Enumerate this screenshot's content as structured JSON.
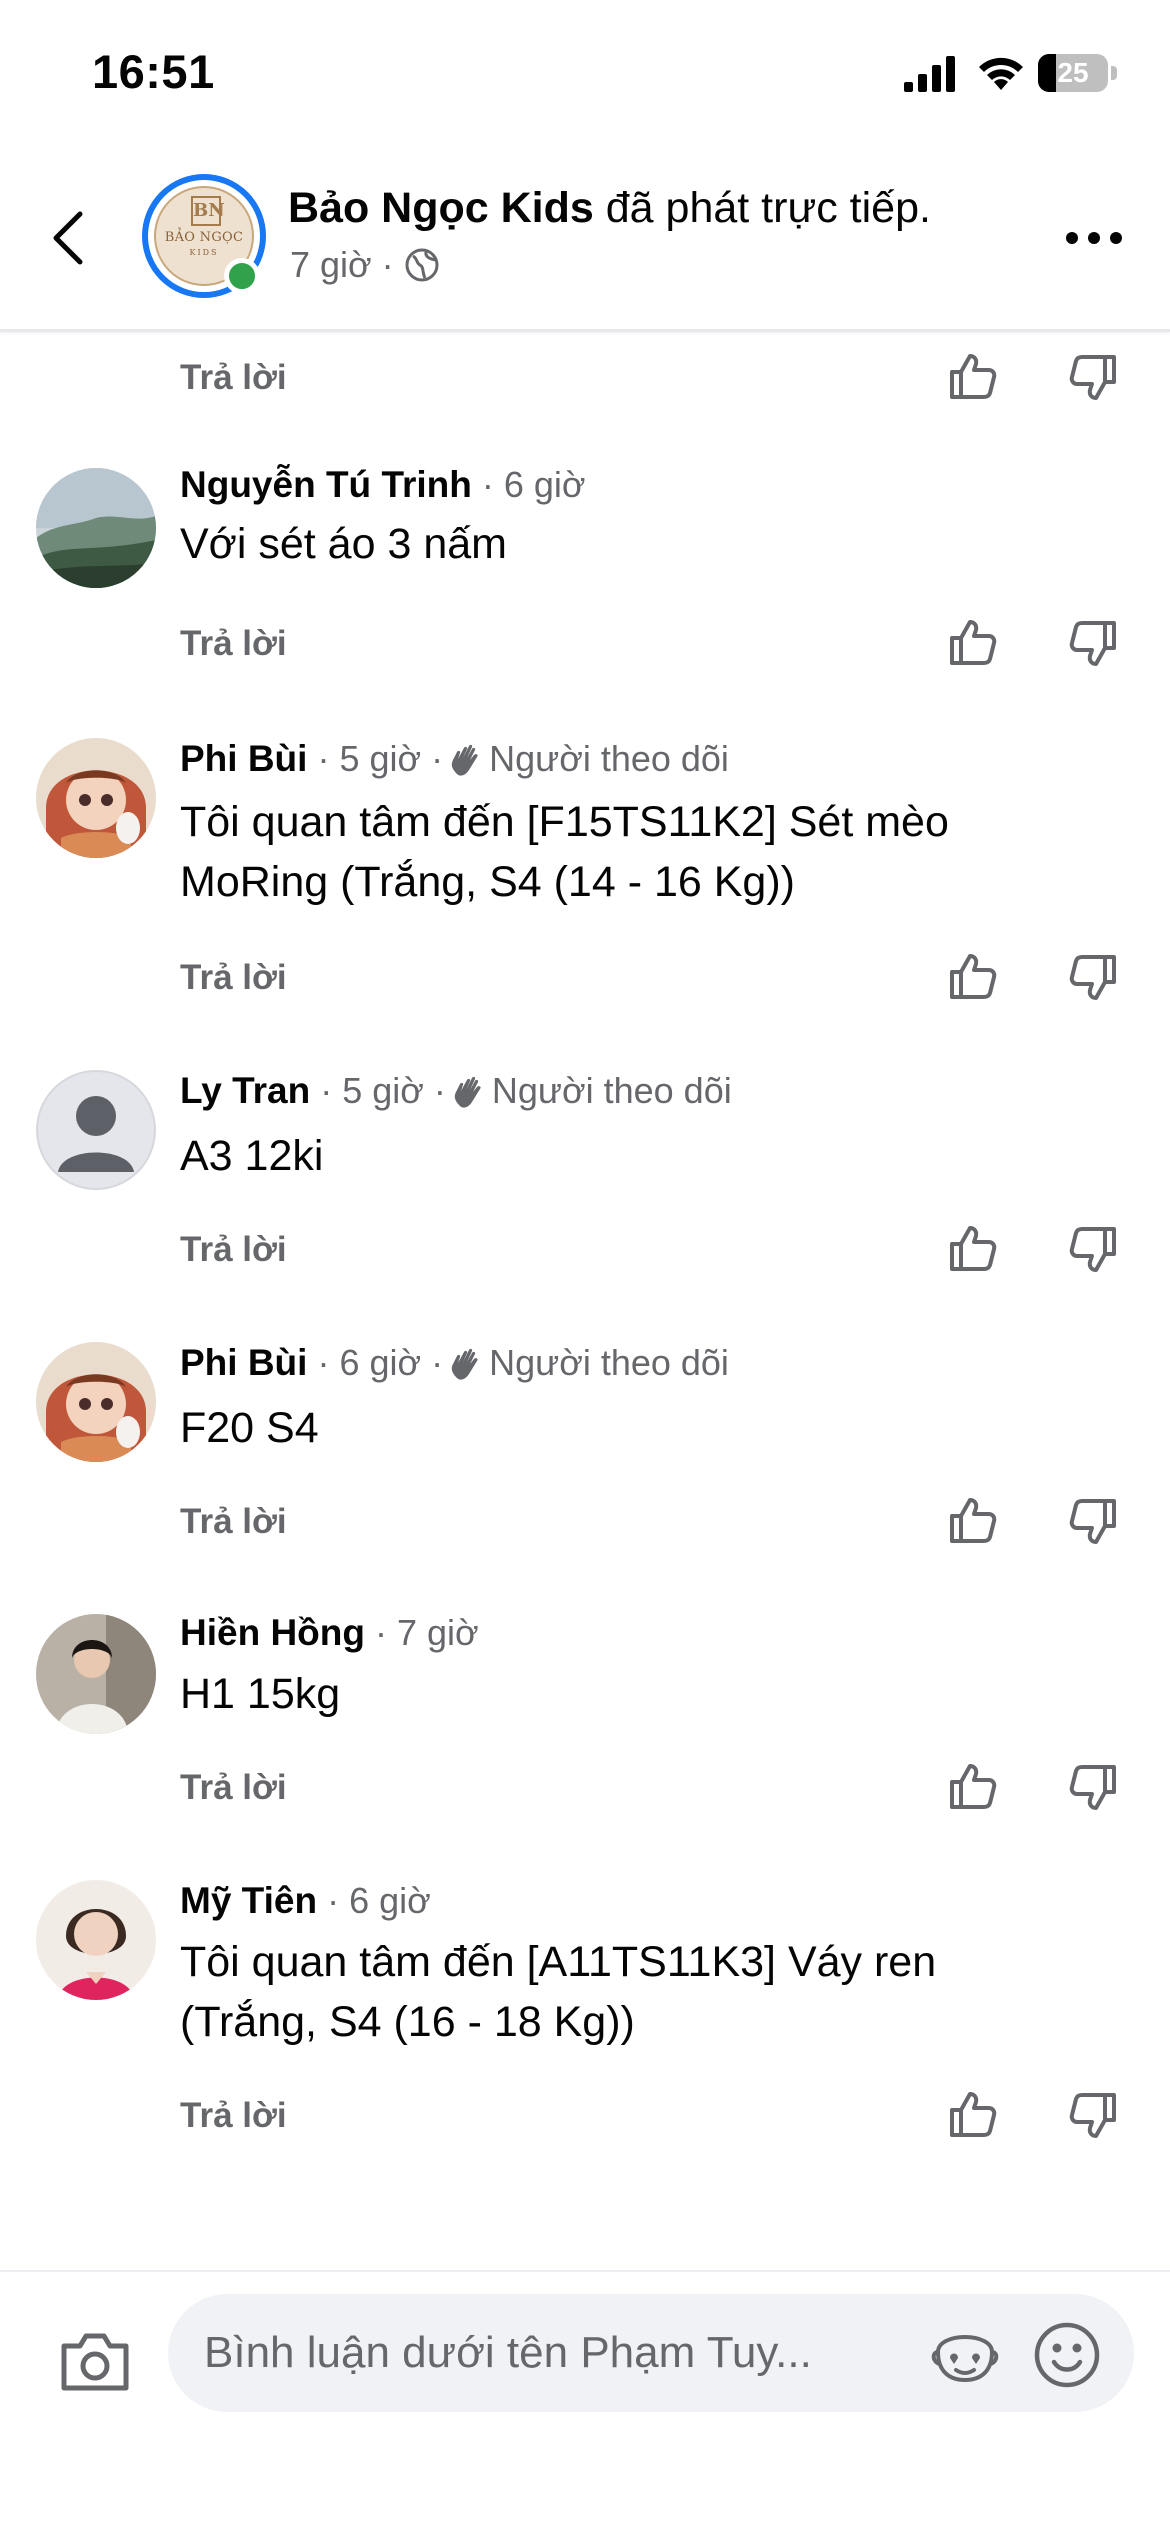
{
  "status_bar": {
    "time": "16:51",
    "battery_level": "25",
    "battery_fraction": 0.25
  },
  "header": {
    "page_name": "Bảo Ngọc Kids",
    "action_text": " đã phát trực tiếp.",
    "time_ago": "7 giờ",
    "separator": "·",
    "logo_monogram": "BN",
    "logo_name": "BẢO NGỌC",
    "logo_sub": "KIDS"
  },
  "reply_label": "Trả lời",
  "follower_badge": "Người theo dõi",
  "comments": [
    {
      "name": "Nguyễn Tú Trinh",
      "time": "· 6 giờ",
      "badge": "",
      "text": "Với sét áo 3 nấm",
      "avatar": "landscape"
    },
    {
      "name": "Phi Bùi",
      "time": "· 5 giờ ·",
      "badge": "Người theo dõi",
      "text": "Tôi quan tâm đến [F15TS11K2] Sét mèo MoRing (Trắng, S4 (14 - 16 Kg))",
      "avatar": "doll"
    },
    {
      "name": "Ly Tran",
      "time": "· 5 giờ ·",
      "badge": "Người theo dõi",
      "text": "A3 12ki",
      "avatar": "default"
    },
    {
      "name": "Phi Bùi",
      "time": "· 6 giờ ·",
      "badge": "Người theo dõi",
      "text": "F20 S4",
      "avatar": "doll"
    },
    {
      "name": "Hiền Hồng",
      "time": "· 7 giờ",
      "badge": "",
      "text": "H1 15kg",
      "avatar": "selfie"
    },
    {
      "name": "Mỹ Tiên",
      "time": "· 6 giờ",
      "badge": "",
      "text": "Tôi quan tâm đến [A11TS11K3] Váy ren (Trắng, S4 (16 - 18 Kg))",
      "avatar": "portrait"
    }
  ],
  "composer": {
    "placeholder": "Bình luận dưới tên Phạm Tuy..."
  },
  "colors": {
    "accent": "#1877f2",
    "online": "#31a24c",
    "secondary_text": "#65676b",
    "input_bg": "#f0f2f5"
  },
  "icons": [
    "back-arrow-icon",
    "globe-icon",
    "more-icon",
    "like-icon",
    "dislike-icon",
    "wave-icon",
    "camera-icon",
    "avatar-mask-icon",
    "emoji-icon",
    "signal-icon",
    "wifi-icon"
  ]
}
